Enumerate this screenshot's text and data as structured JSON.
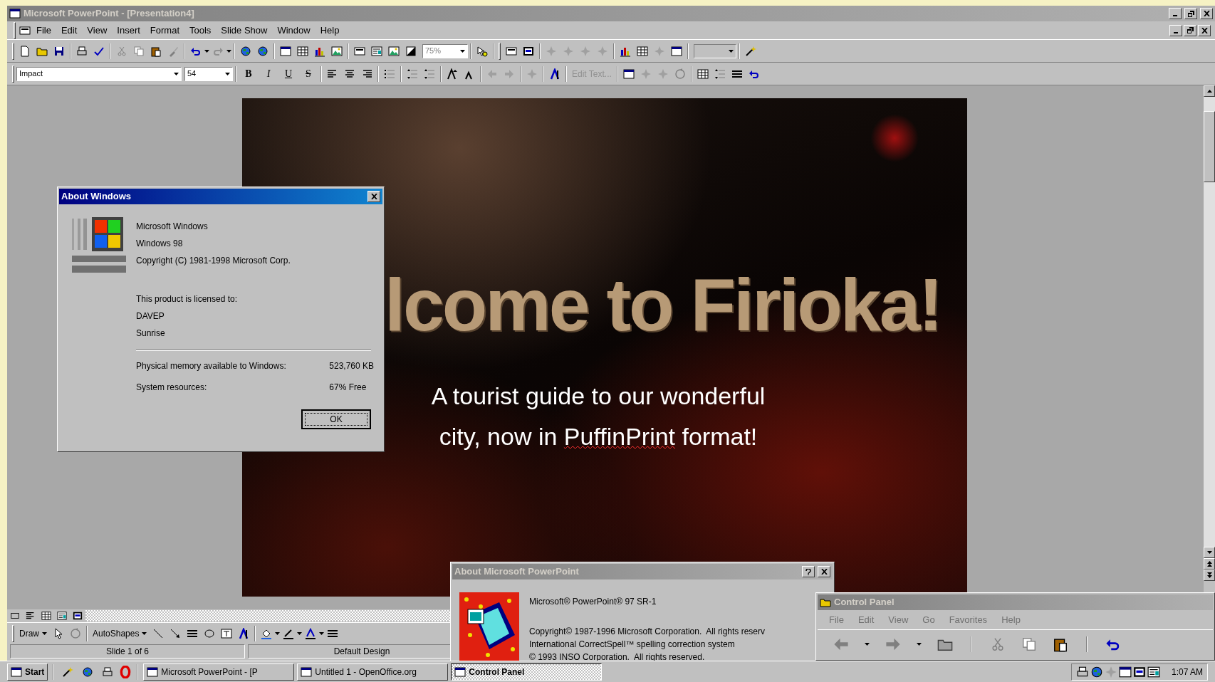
{
  "window": {
    "title": "Microsoft PowerPoint - [Presentation4]",
    "active": false
  },
  "menu": [
    "File",
    "Edit",
    "View",
    "Insert",
    "Format",
    "Tools",
    "Slide Show",
    "Window",
    "Help"
  ],
  "standard_toolbar": {
    "zoom": "75%"
  },
  "formatting_toolbar": {
    "font": "Impact",
    "size": "54",
    "style_buttons": [
      "B",
      "I",
      "U",
      "S"
    ],
    "edit_text": "Edit Text..."
  },
  "slide": {
    "title": "lcome to Firioka!",
    "subtitle_line": "A tourist guide to our wonderful",
    "subtitle_parts": [
      {
        "text": "city, now in ",
        "misspelled": false
      },
      {
        "text": "PuffinPrint",
        "misspelled": true
      },
      {
        "text": " format!",
        "misspelled": false
      }
    ]
  },
  "drawing_toolbar": {
    "draw": "Draw",
    "autoshapes": "AutoShapes"
  },
  "status_bar": [
    "Slide 1 of 6",
    "Default Design"
  ],
  "about_windows": {
    "title": "About Windows",
    "active": true,
    "product": [
      "Microsoft Windows",
      "Windows 98",
      "Copyright (C) 1981-1998 Microsoft Corp."
    ],
    "license": [
      "This product is licensed to:",
      "DAVEP",
      "Sunrise"
    ],
    "memory_label": "Physical memory available to Windows:",
    "memory_value": "523,760 KB",
    "resources_label": "System resources:",
    "resources_value": "67% Free",
    "ok": "OK"
  },
  "about_powerpoint": {
    "title": "About Microsoft PowerPoint",
    "active": false,
    "version": "Microsoft® PowerPoint® 97 SR-1",
    "lines": [
      "Copyright© 1987-1996 Microsoft Corporation.  All rights reserv",
      "International CorrectSpell™ spelling correction system",
      "© 1993 INSO Corporation.  All rights reserved."
    ]
  },
  "control_panel": {
    "title": "Control Panel",
    "active": false,
    "menu": [
      "File",
      "Edit",
      "View",
      "Go",
      "Favorites",
      "Help"
    ]
  },
  "taskbar": {
    "start": "Start",
    "tasks": [
      {
        "label": "Microsoft PowerPoint - [P",
        "selected": false
      },
      {
        "label": "Untitled 1 - OpenOffice.org",
        "selected": false
      },
      {
        "label": "Control Panel",
        "selected": true
      }
    ],
    "clock": "1:07 AM"
  }
}
